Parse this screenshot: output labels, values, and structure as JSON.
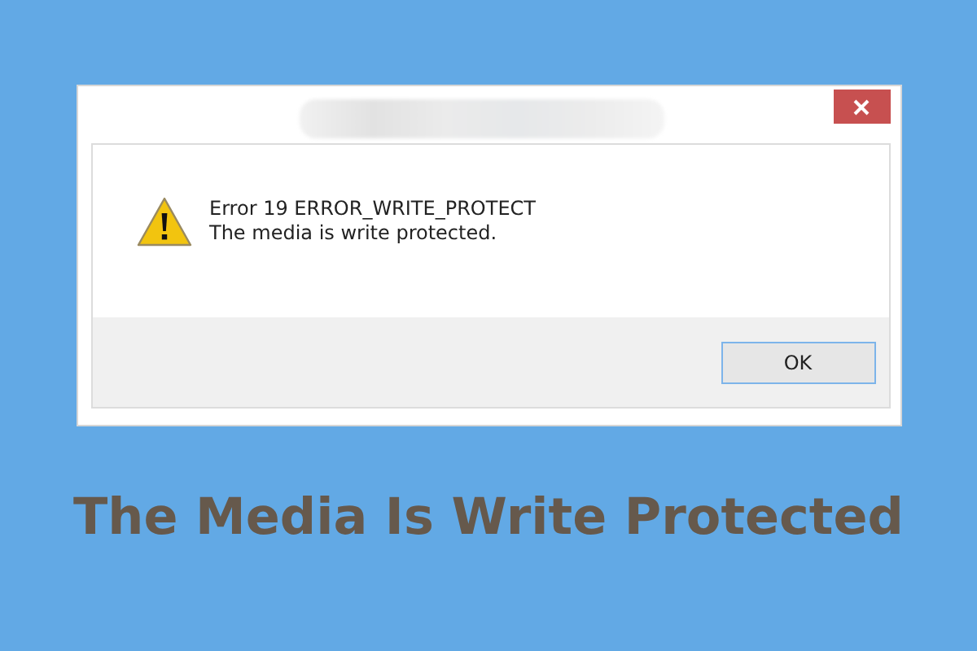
{
  "dialog": {
    "message_lines": [
      "Error 19 ERROR_WRITE_PROTECT",
      "The media is write protected."
    ],
    "buttons": [
      "OK"
    ]
  },
  "caption": "The Media Is Write Protected"
}
